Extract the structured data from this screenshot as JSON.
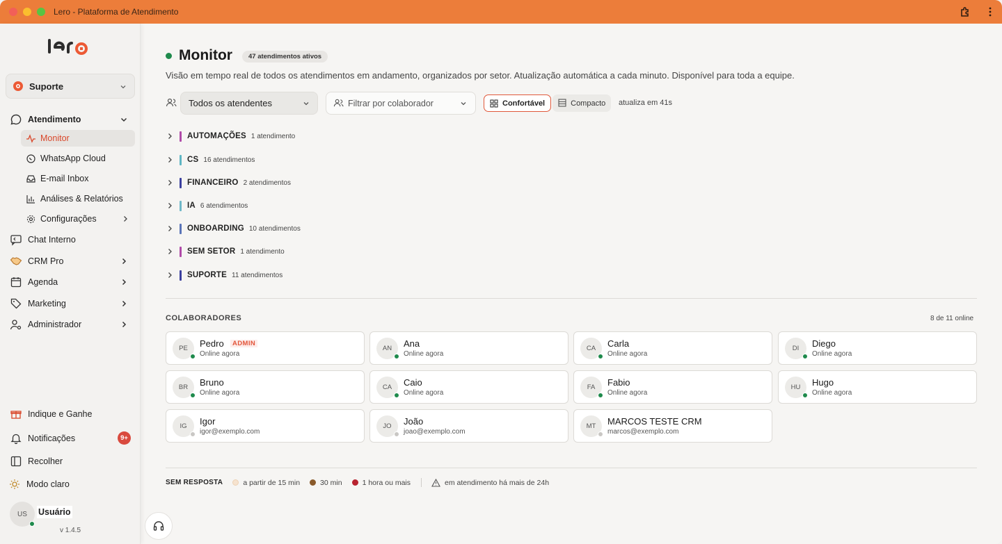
{
  "window": {
    "title": "Lero - Plataforma de Atendimento"
  },
  "brand": {
    "logo_text": "lero",
    "accent": "#ec7d3a",
    "danger": "#e0583a",
    "online": "#1f8a4c"
  },
  "sidebar": {
    "team": "Suporte",
    "group": {
      "label": "Atendimento"
    },
    "subitems": [
      {
        "label": "Monitor",
        "icon": "activity-icon",
        "active": true
      },
      {
        "label": "WhatsApp Cloud",
        "icon": "whatsapp-icon"
      },
      {
        "label": "E-mail Inbox",
        "icon": "inbox-icon"
      },
      {
        "label": "Análises & Relatórios",
        "icon": "bar-chart-icon"
      },
      {
        "label": "Configurações",
        "icon": "gear-icon"
      }
    ],
    "items": [
      {
        "label": "Chat Interno",
        "icon": "chat-icon"
      },
      {
        "label": "CRM Pro",
        "icon": "handshake-icon"
      },
      {
        "label": "Agenda",
        "icon": "calendar-icon"
      },
      {
        "label": "Marketing",
        "icon": "tag-icon"
      },
      {
        "label": "Administrador",
        "icon": "user-gear-icon"
      }
    ],
    "bottom": [
      {
        "label": "Indique e Ganhe",
        "icon": "gift-icon"
      },
      {
        "label": "Notificações",
        "icon": "bell-icon",
        "badge": "9+"
      },
      {
        "label": "Recolher",
        "icon": "sidebar-collapse-icon"
      },
      {
        "label": "Modo claro",
        "icon": "sun-icon"
      }
    ],
    "user": {
      "initials": "US",
      "name": "Usuário"
    },
    "version": "v 1.4.5"
  },
  "main": {
    "title": "Monitor",
    "active_pill": "47 atendimentos ativos",
    "subtitle": "Visão em tempo real de todos os atendimentos em andamento, organizados por setor. Atualização automática a cada minuto. Disponível para toda a equipe.",
    "filters": {
      "agents_select": "Todos os atendentes",
      "collaborator_placeholder": "Filtrar por colaborador",
      "view_comfortable": "Confortável",
      "view_compact": "Compacto",
      "refresh_text": "atualiza em 41s"
    },
    "sectors": [
      {
        "name": "AUTOMAÇÕES",
        "count": "1 atendimento",
        "color": "#b04aa8"
      },
      {
        "name": "CS",
        "count": "16 atendimentos",
        "color": "#5fb6c4"
      },
      {
        "name": "FINANCEIRO",
        "count": "2 atendimentos",
        "color": "#3b3f9e"
      },
      {
        "name": "IA",
        "count": "6 atendimentos",
        "color": "#6fb8c8"
      },
      {
        "name": "ONBOARDING",
        "count": "10 atendimentos",
        "color": "#5a74b8"
      },
      {
        "name": "SEM SETOR",
        "count": "1 atendimento",
        "color": "#b04aa8"
      },
      {
        "name": "SUPORTE",
        "count": "11 atendimentos",
        "color": "#3b3f9e"
      }
    ],
    "collaborators_heading": "COLABORADORES",
    "online_count": "8 de 11 online",
    "collaborators": [
      {
        "initials": "PE",
        "name": "Pedro",
        "status": "Online agora",
        "online": true,
        "badge": "ADMIN"
      },
      {
        "initials": "AN",
        "name": "Ana",
        "status": "Online agora",
        "online": true
      },
      {
        "initials": "CA",
        "name": "Carla",
        "status": "Online agora",
        "online": true
      },
      {
        "initials": "DI",
        "name": "Diego",
        "status": "Online agora",
        "online": true
      },
      {
        "initials": "BR",
        "name": "Bruno",
        "status": "Online agora",
        "online": true
      },
      {
        "initials": "CA",
        "name": "Caio",
        "status": "Online agora",
        "online": true
      },
      {
        "initials": "FA",
        "name": "Fabio",
        "status": "Online agora",
        "online": true
      },
      {
        "initials": "HU",
        "name": "Hugo",
        "status": "Online agora",
        "online": true
      },
      {
        "initials": "IG",
        "name": "Igor",
        "status": "igor@exemplo.com",
        "online": false
      },
      {
        "initials": "JO",
        "name": "João",
        "status": "joao@exemplo.com",
        "online": false
      },
      {
        "initials": "MT",
        "name": "MARCOS TESTE CRM",
        "status": "marcos@exemplo.com",
        "online": false
      }
    ],
    "legend": {
      "heading": "SEM RESPOSTA",
      "items": [
        {
          "label": "a partir de 15 min",
          "color": "#f6e3cf"
        },
        {
          "label": "30 min",
          "color": "#8a5a2b"
        },
        {
          "label": "1 hora ou mais",
          "color": "#b8232f"
        }
      ],
      "warning": "em atendimento há mais de 24h"
    }
  }
}
